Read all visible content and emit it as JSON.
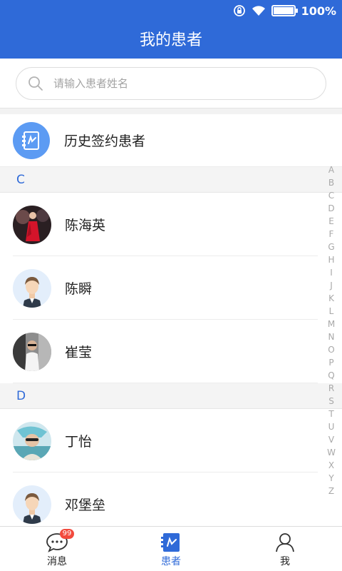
{
  "status_bar": {
    "battery": "100%",
    "battery_level": 1.0
  },
  "header": {
    "title": "我的患者"
  },
  "search": {
    "placeholder": "请输入患者姓名"
  },
  "history": {
    "label": "历史签约患者",
    "icon": "contract-book-icon"
  },
  "sections": [
    {
      "letter": "C",
      "patients": [
        {
          "name": "陈海英"
        },
        {
          "name": "陈瞬"
        },
        {
          "name": "崔莹"
        }
      ]
    },
    {
      "letter": "D",
      "patients": [
        {
          "name": "丁怡"
        },
        {
          "name": "邓堡垒"
        }
      ]
    }
  ],
  "index_letters": [
    "A",
    "B",
    "C",
    "D",
    "E",
    "F",
    "G",
    "H",
    "I",
    "J",
    "K",
    "L",
    "M",
    "N",
    "O",
    "P",
    "Q",
    "R",
    "S",
    "T",
    "U",
    "V",
    "W",
    "X",
    "Y",
    "Z"
  ],
  "tabbar": {
    "tabs": [
      {
        "label": "消息",
        "icon": "chat-bubble-icon",
        "badge": "99"
      },
      {
        "label": "患者",
        "icon": "contract-book-icon",
        "active": true
      },
      {
        "label": "我",
        "icon": "person-icon"
      }
    ]
  },
  "colors": {
    "primary": "#2f6ad8",
    "history_icon_bg": "#5c9bf3",
    "badge": "#f24a3d"
  }
}
